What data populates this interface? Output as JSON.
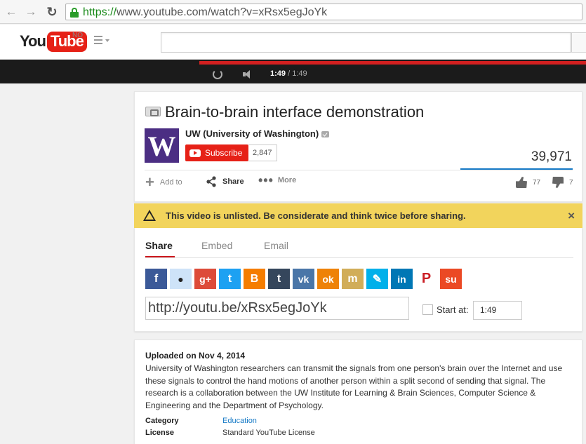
{
  "browser": {
    "url_scheme": "https://",
    "url_rest": "www.youtube.com/watch?v=xRsx5egJoYk"
  },
  "header": {
    "logo_you": "You",
    "logo_tube": "Tube",
    "region": "NO"
  },
  "player": {
    "current_time": "1:49",
    "duration": "/ 1:49",
    "progress": 1.0
  },
  "video": {
    "title": "Brain-to-brain interface demonstration",
    "channel": "UW (University of Washington)",
    "channel_logo": "W",
    "subscribe_label": "Subscribe",
    "subscriber_count": "2,847",
    "views": "39,971",
    "actions": {
      "add_to": "Add to",
      "share": "Share",
      "more": "More"
    },
    "likes": "77",
    "dislikes": "7"
  },
  "banner": {
    "text": "This video is unlisted. Be considerate and think twice before sharing.",
    "close": "×",
    "color": "#f2d45c"
  },
  "share": {
    "tabs": [
      "Share",
      "Embed",
      "Email"
    ],
    "social": [
      {
        "name": "facebook-icon",
        "glyph": "f",
        "color": "#3b5998"
      },
      {
        "name": "reddit-icon",
        "glyph": "●",
        "color": "#cee3f8"
      },
      {
        "name": "google-plus-icon",
        "glyph": "g+",
        "color": "#dd4b39"
      },
      {
        "name": "twitter-icon",
        "glyph": "t",
        "color": "#1da1f2"
      },
      {
        "name": "blogger-icon",
        "glyph": "B",
        "color": "#f57d00"
      },
      {
        "name": "tumblr-icon",
        "glyph": "t",
        "color": "#35465c"
      },
      {
        "name": "vk-icon",
        "glyph": "vk",
        "color": "#4a76a8"
      },
      {
        "name": "odnoklassniki-icon",
        "glyph": "ok",
        "color": "#ee8208"
      },
      {
        "name": "mixi-icon",
        "glyph": "m",
        "color": "#d1ad59"
      },
      {
        "name": "livejournal-icon",
        "glyph": "✎",
        "color": "#00b0ea"
      },
      {
        "name": "linkedin-icon",
        "glyph": "in",
        "color": "#0077b5"
      },
      {
        "name": "pinterest-icon",
        "glyph": "P",
        "color": "#ffffff"
      },
      {
        "name": "stumbleupon-icon",
        "glyph": "su",
        "color": "#eb4924"
      }
    ],
    "short_url": "http://youtu.be/xRsx5egJoYk",
    "start_at_label": "Start at:",
    "start_at_value": "1:49"
  },
  "description": {
    "uploaded": "Uploaded on Nov 4, 2014",
    "text": "University of Washington researchers can transmit the signals from one person's brain over the Internet and use these signals to control the hand motions of another person within a split second of sending that signal. The research is a collaboration between the UW Institute for Learning & Brain Sciences, Computer Science & Engineering and the Department of Psychology.",
    "category_label": "Category",
    "category_value": "Education",
    "license_label": "License",
    "license_value": "Standard YouTube License"
  }
}
